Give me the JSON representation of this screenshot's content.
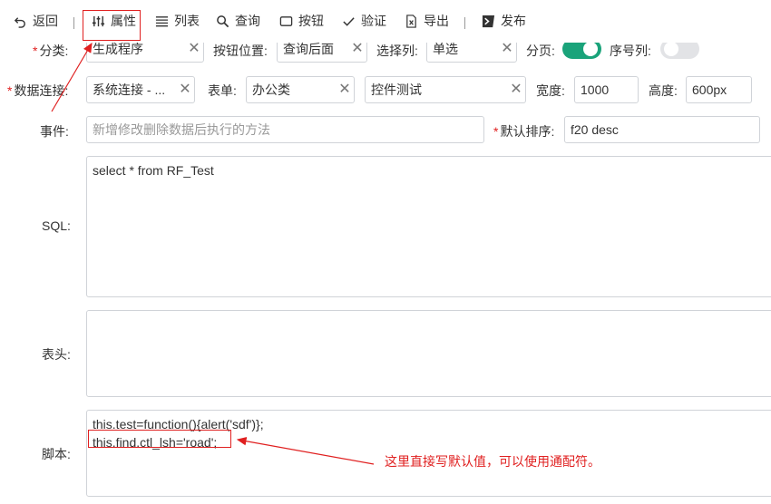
{
  "toolbar": {
    "back": "返回",
    "properties": "属性",
    "list": "列表",
    "query": "查询",
    "button": "按钮",
    "validate": "验证",
    "export": "导出",
    "publish": "发布"
  },
  "form": {
    "category": {
      "label": "分类:",
      "value": "生成程序"
    },
    "button_position": {
      "label": "按钮位置:",
      "value": "查询后面"
    },
    "select_column": {
      "label": "选择列:",
      "value": "单选"
    },
    "paging": {
      "label": "分页:",
      "on": true
    },
    "serial": {
      "label": "序号列:",
      "on": false
    },
    "data_connection": {
      "label": "数据连接:",
      "value": "系统连接 - ..."
    },
    "table_name": {
      "label": "表单:",
      "value": "办公类"
    },
    "control": {
      "value": "控件测试"
    },
    "width": {
      "label": "宽度:",
      "value": "1000"
    },
    "height": {
      "label": "高度:",
      "value": "600px"
    },
    "event": {
      "label": "事件:",
      "placeholder": "新增修改删除数据后执行的方法"
    },
    "default_sort": {
      "label": "默认排序:",
      "value": "f20 desc"
    },
    "sql": {
      "label": "SQL:",
      "value": "select * from RF_Test"
    },
    "header": {
      "label": "表头:",
      "value": ""
    },
    "script": {
      "label": "脚本:",
      "line1": "this.test=function(){alert('sdf')};",
      "line2": "this.find.ctl_lsh='road';"
    }
  },
  "annotation": "这里直接写默认值，可以使用通配符。",
  "colors": {
    "accent": "#1aa37a",
    "highlight": "#e02020"
  }
}
